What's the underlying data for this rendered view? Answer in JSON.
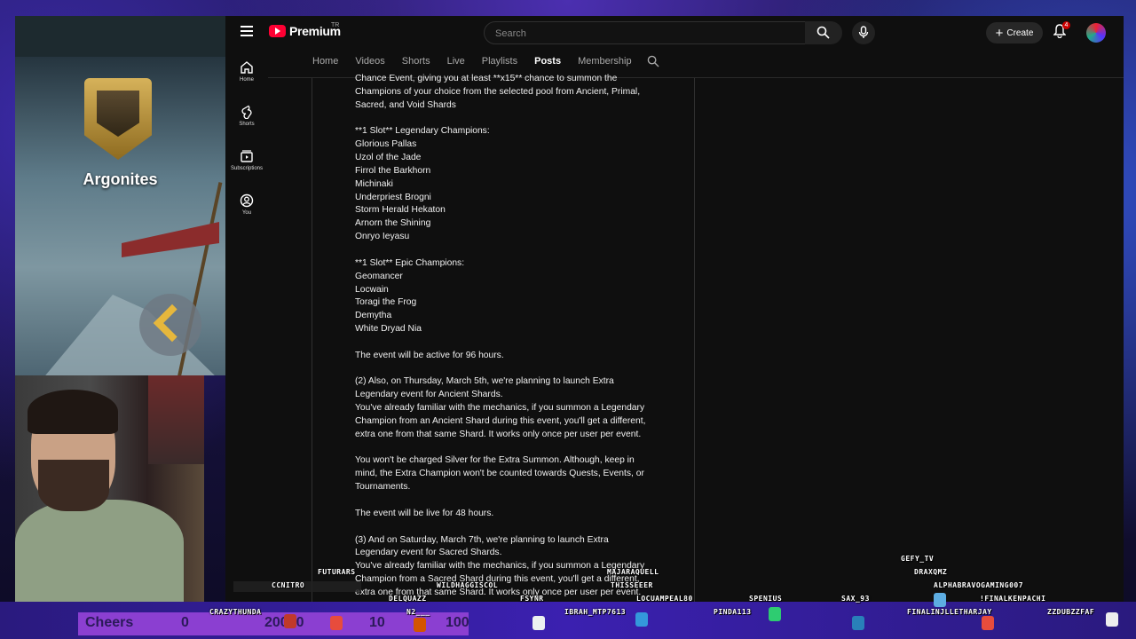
{
  "game": {
    "clan_name": "Argonites"
  },
  "youtube": {
    "logo_text": "Premium",
    "logo_region": "TR",
    "search_placeholder": "Search",
    "create_label": "Create",
    "notification_count": "4",
    "left_nav": [
      {
        "label": "Home",
        "icon": "home-icon"
      },
      {
        "label": "Shorts",
        "icon": "shorts-icon"
      },
      {
        "label": "Subscriptions",
        "icon": "subscriptions-icon"
      },
      {
        "label": "You",
        "icon": "you-icon"
      }
    ],
    "tabs": [
      {
        "label": "Home",
        "active": false
      },
      {
        "label": "Videos",
        "active": false
      },
      {
        "label": "Shorts",
        "active": false
      },
      {
        "label": "Live",
        "active": false
      },
      {
        "label": "Playlists",
        "active": false
      },
      {
        "label": "Posts",
        "active": true
      },
      {
        "label": "Membership",
        "active": false
      }
    ],
    "post_text": "Chance Event, giving you at least **x15** chance to summon the\nChampions of your choice from the selected pool from Ancient, Primal,\nSacred, and Void Shards\n\n**1 Slot** Legendary Champions:\nGlorious Pallas\nUzol of the Jade\nFirrol the Barkhorn\nMichinaki\nUnderpriest Brogni\nStorm Herald Hekaton\nArnorn the Shining\nOnryo Ieyasu\n\n**1 Slot** Epic Champions:\nGeomancer\nLocwain\nToragi the Frog\nDemytha\nWhite Dryad Nia\n\nThe event will be active for 96 hours.\n\n(2) Also, on Thursday, March 5th, we're planning to launch Extra\nLegendary event for Ancient Shards.\nYou've already familiar with the mechanics, if you summon a Legendary\nChampion from an Ancient Shard during this event, you'll get a different,\nextra one from that same Shard. It works only once per user per event.\n\nYou won't be charged Silver for the Extra Summon. Although, keep in\nmind, the Extra Champion won't be counted towards Quests, Events, or\nTournaments.\n\nThe event will be live for 48 hours.\n\n(3) And on Saturday, March 7th, we're planning to launch Extra\nLegendary event for Sacred Shards.\nYou've already familiar with the mechanics, if you summon a Legendary\nChampion from a Sacred Shard during this event, you'll get a different,\nextra one from that same Shard. It works only once per user per event."
  },
  "overlay": {
    "cheers_label": "Cheers",
    "cheers_values": [
      "0",
      "0",
      "20000",
      "10",
      "100"
    ],
    "chat_names": [
      "GEFY_TV",
      "DRAXQMZ",
      "ALPHABRAVOGAMING007",
      "FUTURARS",
      "CCNITRO",
      "MAJARAQUELL",
      "WILDHAGGISCOL",
      "THISSEEER",
      "DELQUAZZ",
      "FSYNR",
      "LOCUAMPEAL80",
      "SPENIUS",
      "SAX_93",
      "!FINALKENPACHI",
      "CRAZYTHUNDA",
      "N2___",
      "IBRAH_MTP7613",
      "PINDA113",
      "FINALINJLLETHARJAY",
      "ZZDUBZZFAF"
    ]
  }
}
